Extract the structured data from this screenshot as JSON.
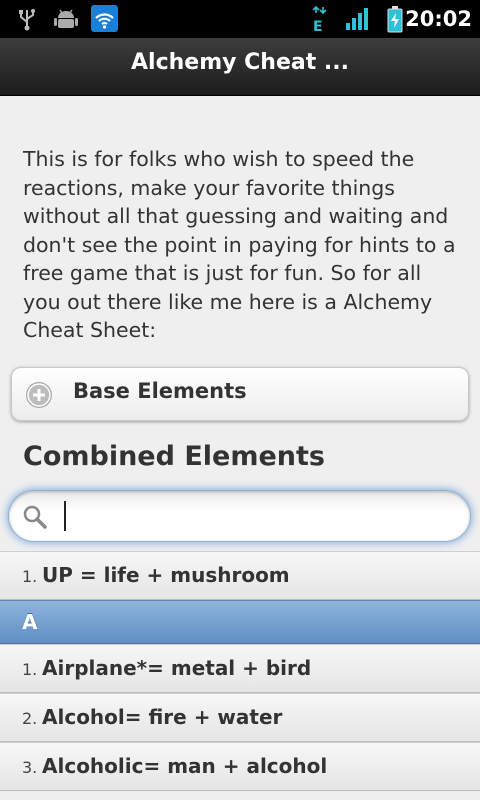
{
  "status_bar": {
    "time": "20:02",
    "icons": [
      "usb-icon",
      "android-debug-icon",
      "wifi-icon",
      "edge-data-icon",
      "signal-icon",
      "battery-charging-icon"
    ],
    "network_label": "E"
  },
  "header": {
    "title": "Alchemy Cheat ..."
  },
  "intro": {
    "text": "This is for folks who wish to speed the reactions, make your favorite things without all that guessing and waiting and don't see the point in paying for hints to a free game that is just for fun. So for all you out there like me here is a Alchemy Cheat Sheet:"
  },
  "collapsible": {
    "label": "Base Elements",
    "icon": "plus-icon"
  },
  "section": {
    "heading": "Combined Elements"
  },
  "search": {
    "value": "",
    "placeholder": "",
    "icon": "search-icon"
  },
  "list": {
    "items": [
      {
        "num": "1.",
        "text": "UP = life + mushroom"
      }
    ],
    "divider_a": "A",
    "a_items": [
      {
        "num": "1.",
        "text": "Airplane*= metal + bird"
      },
      {
        "num": "2.",
        "text": "Alcohol= fire + water"
      },
      {
        "num": "3.",
        "text": "Alcoholic= man + alcohol"
      }
    ]
  },
  "colors": {
    "accent": "#6a9fd8",
    "divider": "#7aa4d0",
    "titlebar": "#2a2a2a"
  }
}
